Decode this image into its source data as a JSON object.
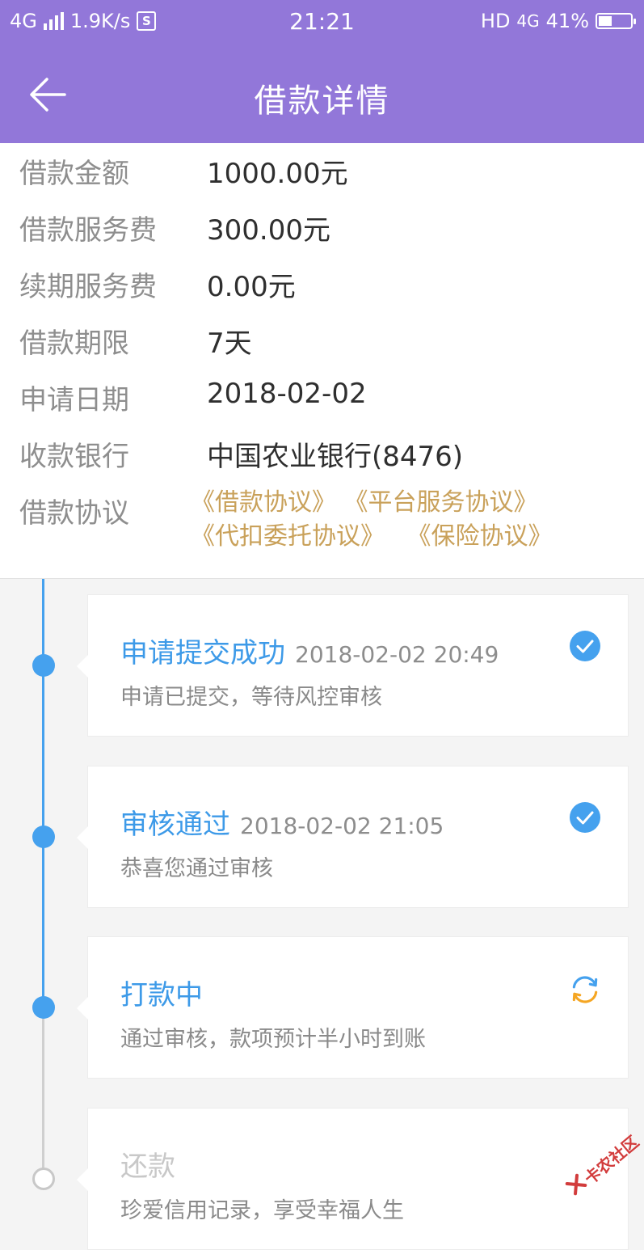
{
  "status_bar": {
    "network_left": "4G",
    "speed": "1.9K/s",
    "s_badge": "S",
    "time": "21:21",
    "hd": "HD",
    "network_right": "4G",
    "battery_percent_text": "41%",
    "battery_level": 0.41
  },
  "header": {
    "title": "借款详情",
    "back_icon": "arrow-left-icon"
  },
  "details": [
    {
      "label": "借款金额",
      "value": "1000.00元"
    },
    {
      "label": "借款服务费",
      "value": "300.00元"
    },
    {
      "label": "续期服务费",
      "value": "0.00元"
    },
    {
      "label": "借款期限",
      "value": "7天"
    },
    {
      "label": "申请日期",
      "value": "2018-02-02"
    },
    {
      "label": "收款银行",
      "value": "中国农业银行(8476)"
    }
  ],
  "agreements": {
    "label": "借款协议",
    "links": [
      "《借款协议》",
      "《平台服务协议》",
      "《代扣委托协议》",
      "《保险协议》"
    ]
  },
  "timeline": [
    {
      "title": "申请提交成功",
      "time": "2018-02-02 20:49",
      "desc": "申请已提交，等待风控审核",
      "status_icon": "check-circle-icon",
      "state": "done"
    },
    {
      "title": "审核通过",
      "time": "2018-02-02 21:05",
      "desc": "恭喜您通过审核",
      "status_icon": "check-circle-icon",
      "state": "done"
    },
    {
      "title": "打款中",
      "time": "",
      "desc": "通过审核，款项预计半小时到账",
      "status_icon": "refresh-icon",
      "state": "active"
    },
    {
      "title": "还款",
      "time": "",
      "desc": "珍爱信用记录，享受幸福人生",
      "status_icon": "",
      "state": "pending"
    }
  ],
  "watermark": {
    "text": "卡农社区"
  },
  "colors": {
    "header": "#9277d9",
    "accent_blue": "#45a1ee",
    "agreement_gold": "#c9a15a",
    "refresh_orange": "#f5a623"
  }
}
